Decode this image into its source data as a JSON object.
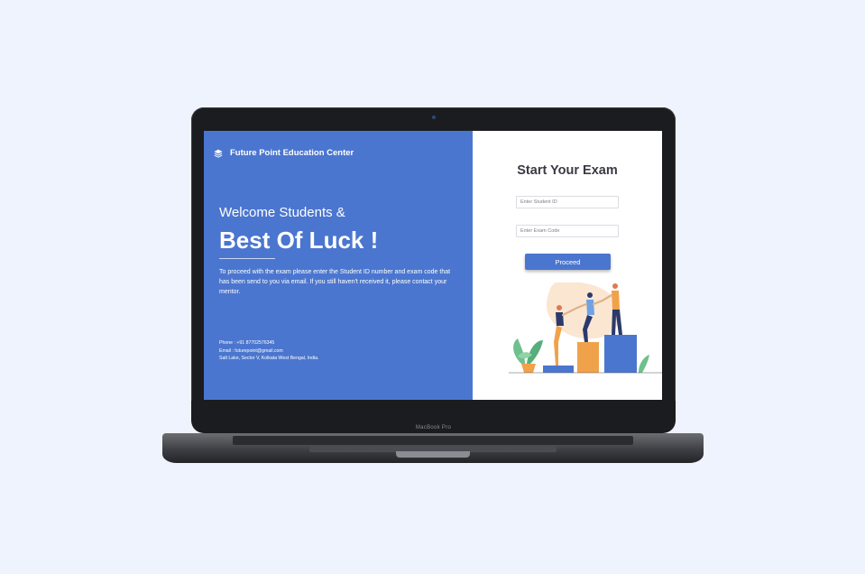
{
  "device": {
    "brand_label": "MacBook Pro"
  },
  "header": {
    "org_name": "Future Point Education Center"
  },
  "hero": {
    "welcome": "Welcome Students &",
    "headline": "Best Of Luck !",
    "instructions": "To proceed with the exam please enter the Student ID number and exam code that has been send to you via email. If you still haven't received it, please contact your mentor."
  },
  "contact": {
    "phone": "Phone : +91 87702576345",
    "email": "Email : futurepoint@gmail.com",
    "address": "Salt Lake, Sector V, Kolkata West Bengal, India."
  },
  "form": {
    "title": "Start Your Exam",
    "student_id": {
      "placeholder": "Enter Student ID",
      "value": ""
    },
    "exam_code": {
      "placeholder": "Enter Exam Code",
      "value": ""
    },
    "submit_label": "Proceed"
  },
  "icons": {
    "logo": "layers-icon",
    "illustration": "teamwork-climbing-illustration"
  },
  "colors": {
    "primary": "#4b76cf",
    "page_bg": "#eef3fd",
    "title_text": "#3a3a44",
    "accent_orange": "#f0a24a"
  }
}
